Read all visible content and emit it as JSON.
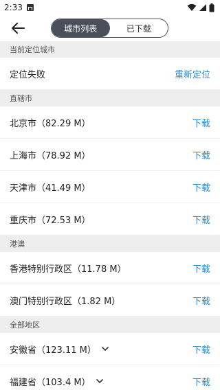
{
  "status_bar": {
    "time": "2:33"
  },
  "header": {
    "tabs": [
      {
        "label": "城市列表",
        "active": true
      },
      {
        "label": "已下载",
        "active": false
      }
    ]
  },
  "sections": {
    "current": {
      "title": "当前定位城市",
      "location_status": "定位失败",
      "relocate": "重新定位"
    },
    "municipalities": {
      "title": "直辖市",
      "items": [
        {
          "label": "北京市（82.29 M）",
          "action": "下载"
        },
        {
          "label": "上海市（78.92 M）",
          "action": "下载"
        },
        {
          "label": "天津市（41.49 M）",
          "action": "下载"
        },
        {
          "label": "重庆市（72.53 M）",
          "action": "下载"
        }
      ]
    },
    "hkmo": {
      "title": "港澳",
      "items": [
        {
          "label": "香港特别行政区（11.78 M）",
          "action": "下载"
        },
        {
          "label": "澳门特别行政区（1.82 M）",
          "action": "下载"
        }
      ]
    },
    "all": {
      "title": "全部地区",
      "items": [
        {
          "label": "安徽省（123.11 M）",
          "action": "下载"
        },
        {
          "label": "福建省（103.4 M）",
          "action": "下载"
        }
      ]
    }
  },
  "colors": {
    "accent": "#2a8ad6",
    "segment_dark": "#4a4f59",
    "section_bg": "#eeeeee"
  }
}
